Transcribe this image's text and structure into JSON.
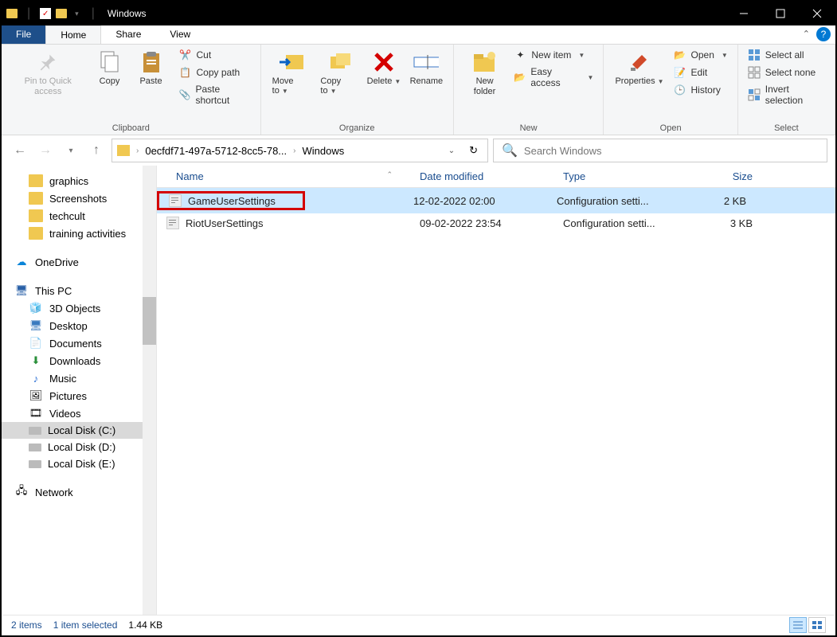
{
  "title": "Windows",
  "tabs": {
    "file": "File",
    "home": "Home",
    "share": "Share",
    "view": "View"
  },
  "ribbon": {
    "clipboard": {
      "label": "Clipboard",
      "pin": "Pin to Quick access",
      "copy": "Copy",
      "paste": "Paste",
      "cut": "Cut",
      "copypath": "Copy path",
      "shortcut": "Paste shortcut"
    },
    "organize": {
      "label": "Organize",
      "moveto": "Move to",
      "copyto": "Copy to",
      "delete": "Delete",
      "rename": "Rename"
    },
    "new": {
      "label": "New",
      "newfolder": "New folder",
      "newitem": "New item",
      "easyaccess": "Easy access"
    },
    "open": {
      "label": "Open",
      "properties": "Properties",
      "open": "Open",
      "edit": "Edit",
      "history": "History"
    },
    "select": {
      "label": "Select",
      "all": "Select all",
      "none": "Select none",
      "invert": "Invert selection"
    }
  },
  "address": {
    "crumb1": "0ecfdf71-497a-5712-8cc5-78...",
    "crumb2": "Windows"
  },
  "search_placeholder": "Search Windows",
  "sidebar": {
    "graphics": "graphics",
    "screenshots": "Screenshots",
    "techcult": "techcult",
    "training": "training activities",
    "onedrive": "OneDrive",
    "thispc": "This PC",
    "objects3d": "3D Objects",
    "desktop": "Desktop",
    "documents": "Documents",
    "downloads": "Downloads",
    "music": "Music",
    "pictures": "Pictures",
    "videos": "Videos",
    "diskc": "Local Disk (C:)",
    "diskd": "Local Disk (D:)",
    "diske": "Local Disk (E:)",
    "network": "Network"
  },
  "columns": {
    "name": "Name",
    "date": "Date modified",
    "type": "Type",
    "size": "Size"
  },
  "files": [
    {
      "name": "GameUserSettings",
      "date": "12-02-2022 02:00",
      "type": "Configuration setti...",
      "size": "2 KB"
    },
    {
      "name": "RiotUserSettings",
      "date": "09-02-2022 23:54",
      "type": "Configuration setti...",
      "size": "3 KB"
    }
  ],
  "status": {
    "items": "2 items",
    "selected": "1 item selected",
    "size": "1.44 KB"
  }
}
